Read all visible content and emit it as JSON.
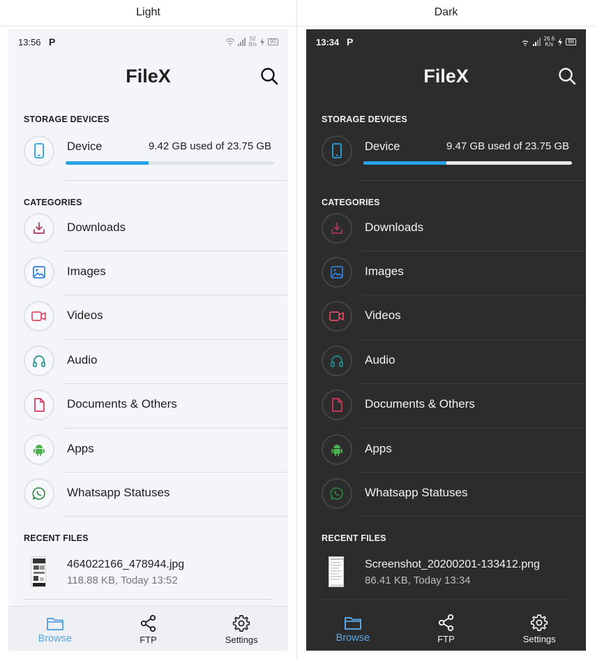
{
  "headers": {
    "light": "Light",
    "dark": "Dark"
  },
  "colors": {
    "accent": "#27a2e4",
    "downloads": "#a8395a",
    "images": "#2f7fd8",
    "videos": "#e04a61",
    "audio": "#1e8f94",
    "documents": "#d9375b",
    "apps": "#4caf50",
    "whatsapp": "#2a8a3e"
  },
  "light": {
    "status": {
      "time": "13:56",
      "carrier_icon": "P",
      "speed_value": "52",
      "speed_unit": "B/s",
      "battery": "90"
    },
    "app_title": "FileX",
    "storage_section": "STORAGE DEVICES",
    "device": {
      "name": "Device",
      "usage": "9.42 GB used of 23.75 GB",
      "used_fraction": 0.397
    },
    "categories_section": "CATEGORIES",
    "categories": [
      {
        "label": "Downloads",
        "icon": "download-icon"
      },
      {
        "label": "Images",
        "icon": "image-icon"
      },
      {
        "label": "Videos",
        "icon": "video-icon"
      },
      {
        "label": "Audio",
        "icon": "headphones-icon"
      },
      {
        "label": "Documents & Others",
        "icon": "document-icon"
      },
      {
        "label": "Apps",
        "icon": "android-icon"
      },
      {
        "label": "Whatsapp Statuses",
        "icon": "whatsapp-icon"
      }
    ],
    "recent_section": "RECENT FILES",
    "recent_file": {
      "name": "464022166_478944.jpg",
      "meta": "118.88 KB, Today 13:52"
    },
    "nav": {
      "browse": "Browse",
      "ftp": "FTP",
      "settings": "Settings"
    }
  },
  "dark": {
    "status": {
      "time": "13:34",
      "carrier_icon": "P",
      "speed_value": "26.6",
      "speed_unit": "K/s",
      "battery": "88"
    },
    "app_title": "FileX",
    "storage_section": "STORAGE DEVICES",
    "device": {
      "name": "Device",
      "usage": "9.47 GB used of 23.75 GB",
      "used_fraction": 0.399
    },
    "categories_section": "CATEGORIES",
    "categories": [
      {
        "label": "Downloads",
        "icon": "download-icon"
      },
      {
        "label": "Images",
        "icon": "image-icon"
      },
      {
        "label": "Videos",
        "icon": "video-icon"
      },
      {
        "label": "Audio",
        "icon": "headphones-icon"
      },
      {
        "label": "Documents & Others",
        "icon": "document-icon"
      },
      {
        "label": "Apps",
        "icon": "android-icon"
      },
      {
        "label": "Whatsapp Statuses",
        "icon": "whatsapp-icon"
      }
    ],
    "recent_section": "RECENT FILES",
    "recent_file": {
      "name": "Screenshot_20200201-133412.png",
      "meta": "86.41 KB, Today 13:34"
    },
    "nav": {
      "browse": "Browse",
      "ftp": "FTP",
      "settings": "Settings"
    }
  }
}
